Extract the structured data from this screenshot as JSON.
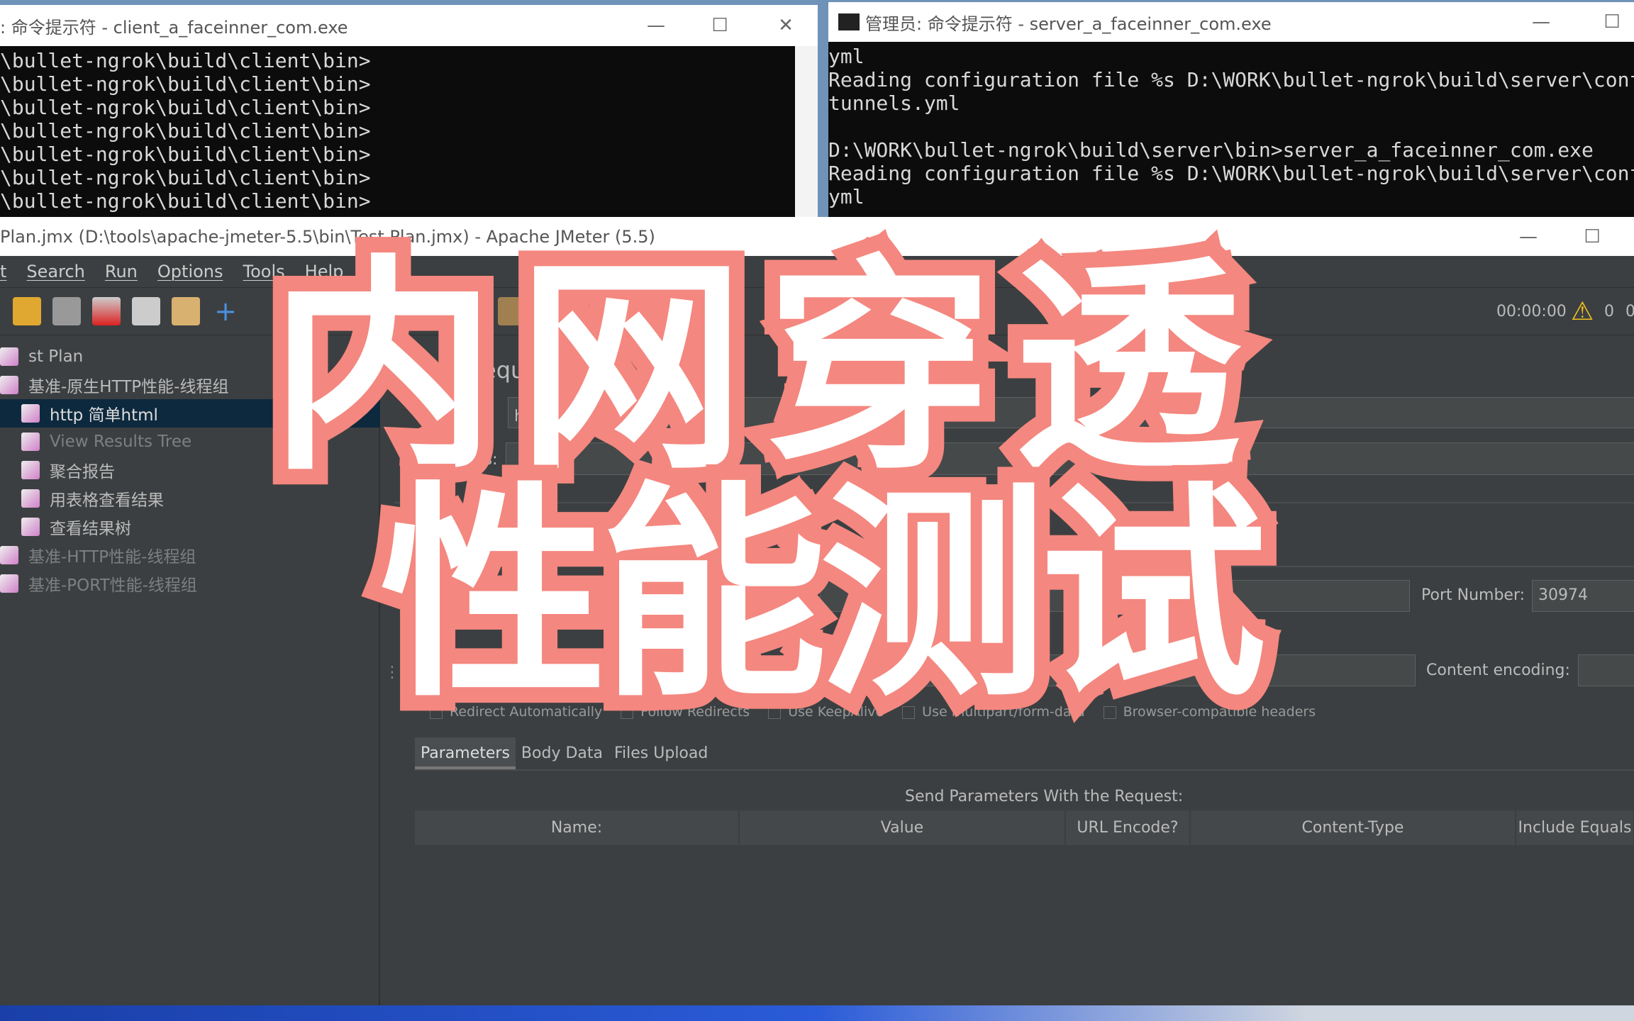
{
  "client_window": {
    "title": ": 命令提示符 - client_a_faceinner_com.exe",
    "lines": [
      "\\bullet-ngrok\\build\\client\\bin>",
      "\\bullet-ngrok\\build\\client\\bin>",
      "\\bullet-ngrok\\build\\client\\bin>",
      "\\bullet-ngrok\\build\\client\\bin>",
      "\\bullet-ngrok\\build\\client\\bin>",
      "\\bullet-ngrok\\build\\client\\bin>",
      "\\bullet-ngrok\\build\\client\\bin>"
    ]
  },
  "server_window": {
    "title": "管理员: 命令提示符 - server_a_faceinner_com.exe",
    "lines": [
      "yml",
      "Reading configuration file %s D:\\WORK\\bullet-ngrok\\build\\server\\conf/se",
      "tunnels.yml",
      "",
      "D:\\WORK\\bullet-ngrok\\build\\server\\bin>server_a_faceinner_com.exe",
      "Reading configuration file %s D:\\WORK\\bullet-ngrok\\build\\server\\conf\\se",
      "yml"
    ]
  },
  "jmeter": {
    "title": "Plan.jmx (D:\\tools\\apache-jmeter-5.5\\bin\\Test Plan.jmx) - Apache JMeter (5.5)",
    "menu": [
      "t",
      "Search",
      "Run",
      "Options",
      "Tools",
      "Help"
    ],
    "timer": "00:00:00",
    "warning_count": "0",
    "thread_count": "0",
    "tree": [
      {
        "label": "st Plan",
        "level": 0
      },
      {
        "label": "基准-原生HTTP性能-线程组",
        "level": 0
      },
      {
        "label": "http 简单html",
        "level": 1,
        "selected": true
      },
      {
        "label": "View Results Tree",
        "level": 1,
        "disabled": true
      },
      {
        "label": "聚合报告",
        "level": 1
      },
      {
        "label": "用表格查看结果",
        "level": 1
      },
      {
        "label": "查看结果树",
        "level": 1
      },
      {
        "label": "基准-HTTP性能-线程组",
        "level": 0,
        "disabled": true
      },
      {
        "label": "基准-PORT性能-线程组",
        "level": 0,
        "disabled": true
      }
    ],
    "panel_title": "equest",
    "name_value": "http 简",
    "comments_label": "ts:",
    "port_label": "Port Number:",
    "port_value": "30974",
    "encoding_label": "Content encoding:",
    "checkboxes": [
      "Redirect Automatically",
      "Follow Redirects",
      "Use KeepAlive",
      "Use multipart/form-data",
      "Browser-compatible headers"
    ],
    "tabs": [
      "Parameters",
      "Body Data",
      "Files Upload"
    ],
    "params_caption": "Send Parameters With the Request:",
    "columns": [
      "Name:",
      "Value",
      "URL Encode?",
      "Content-Type",
      "Include Equals"
    ]
  },
  "overlay": {
    "line1": "内网穿透",
    "line2": "性能测试",
    "stroke_color": "#f4877f"
  }
}
